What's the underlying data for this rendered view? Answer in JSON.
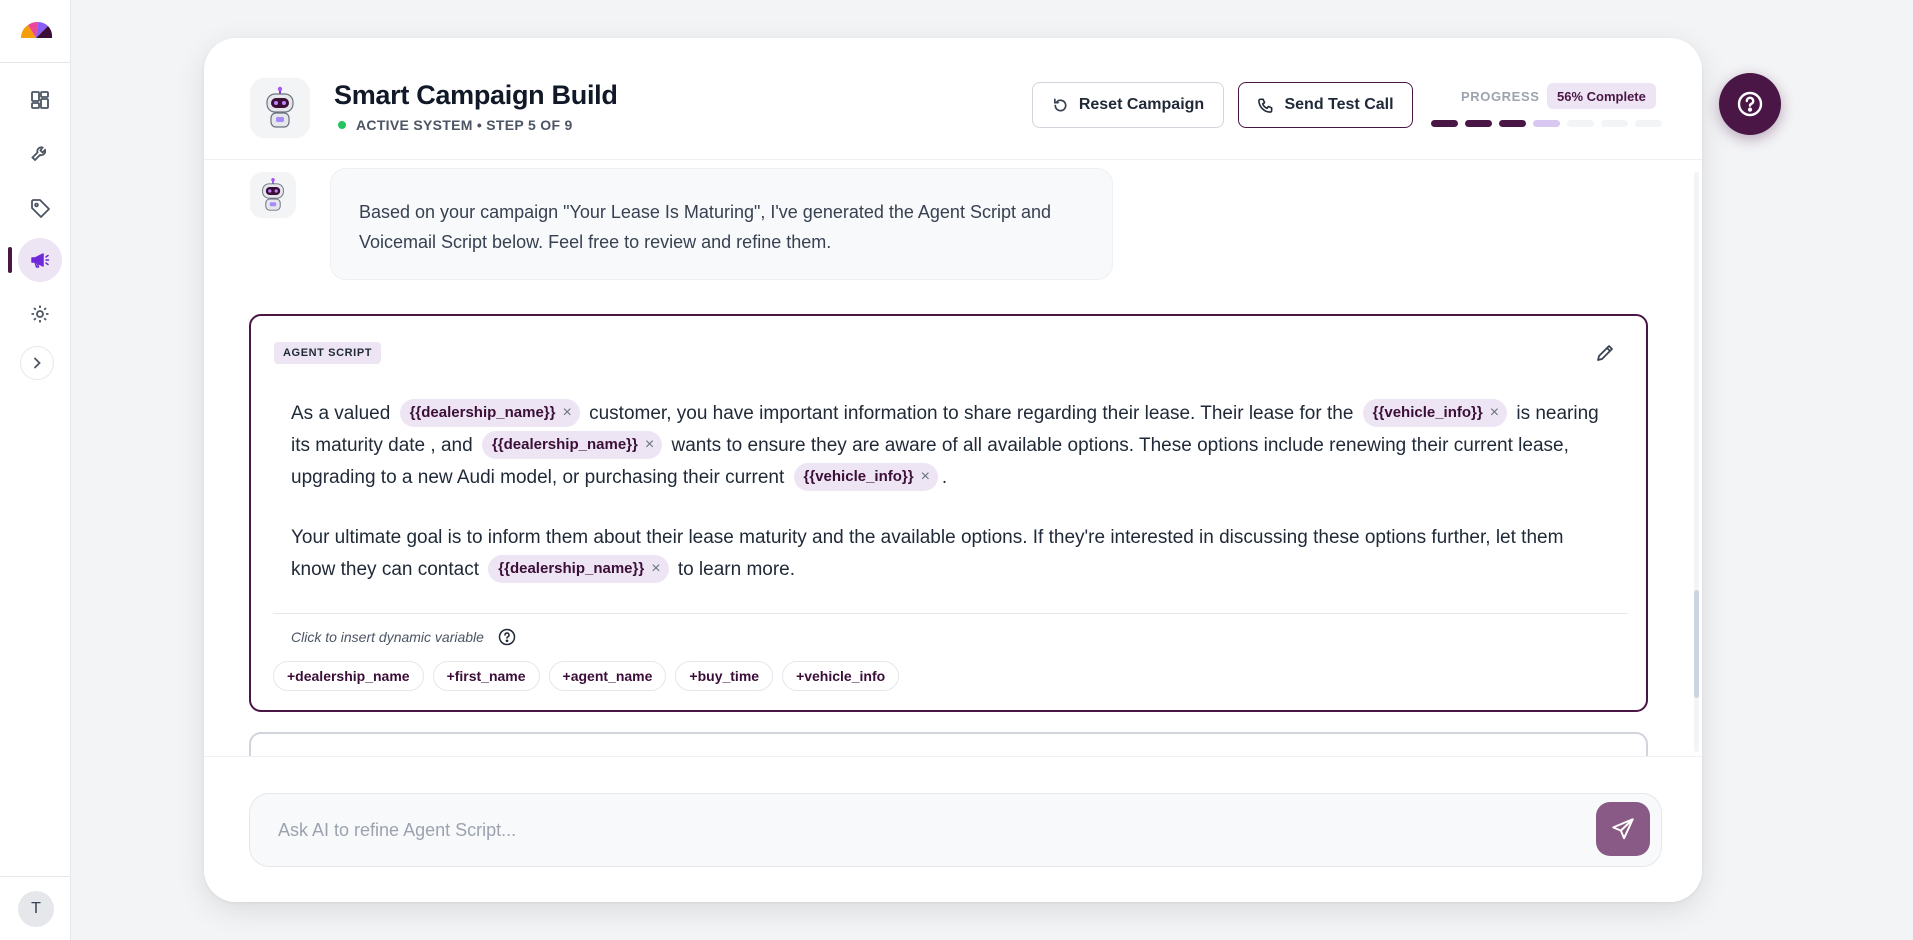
{
  "app": {
    "title": "Smart Campaign Build",
    "status": "ACTIVE SYSTEM • STEP 5 OF 9",
    "accent_color": "#4a1646",
    "status_color": "#22c55e"
  },
  "sidebar": {
    "items": [
      {
        "icon": "dashboard-icon",
        "label": "Dashboard"
      },
      {
        "icon": "wrench-icon",
        "label": "Tools"
      },
      {
        "icon": "tag-icon",
        "label": "Tags"
      },
      {
        "icon": "megaphone-icon",
        "label": "Campaigns",
        "active": true
      },
      {
        "icon": "gear-icon",
        "label": "Settings"
      }
    ],
    "expand_icon": "chevron-right-icon",
    "user_initial": "T"
  },
  "header": {
    "reset_label": "Reset Campaign",
    "test_call_label": "Send Test Call",
    "progress_label": "PROGRESS",
    "progress_badge": "56% Complete",
    "progress_total_steps": 7,
    "progress_completed_steps": 3,
    "progress_current_step": 4
  },
  "chat": {
    "message": "Based on your campaign \"Your Lease Is Maturing\", I've generated the Agent Script and Voicemail Script below. Feel free to review and refine them."
  },
  "script": {
    "label": "AGENT SCRIPT",
    "p1": {
      "t1": "As a valued",
      "v1": "{{dealership_name}}",
      "t2": "customer, you have important information to share regarding their lease. Their lease for the",
      "v2": "{{vehicle_info}}",
      "t3": "is nearing its maturity date , and",
      "v3": "{{dealership_name}}",
      "t4": "wants to ensure they are aware of all available options. These options include renewing their current lease, upgrading to a new Audi model, or purchasing their current",
      "v4": "{{vehicle_info}}",
      "t5": "."
    },
    "p2": {
      "t1": "Your ultimate goal is to inform them about their lease maturity and the available options. If they're interested in discussing these options further, let them know they can contact",
      "v1": "{{dealership_name}}",
      "t2": "to learn more."
    },
    "chip_remove": "×",
    "vars_hint": "Click to insert dynamic variable",
    "variables": [
      "+dealership_name",
      "+first_name",
      "+agent_name",
      "+buy_time",
      "+vehicle_info"
    ]
  },
  "input": {
    "placeholder": "Ask AI to refine Agent Script..."
  }
}
